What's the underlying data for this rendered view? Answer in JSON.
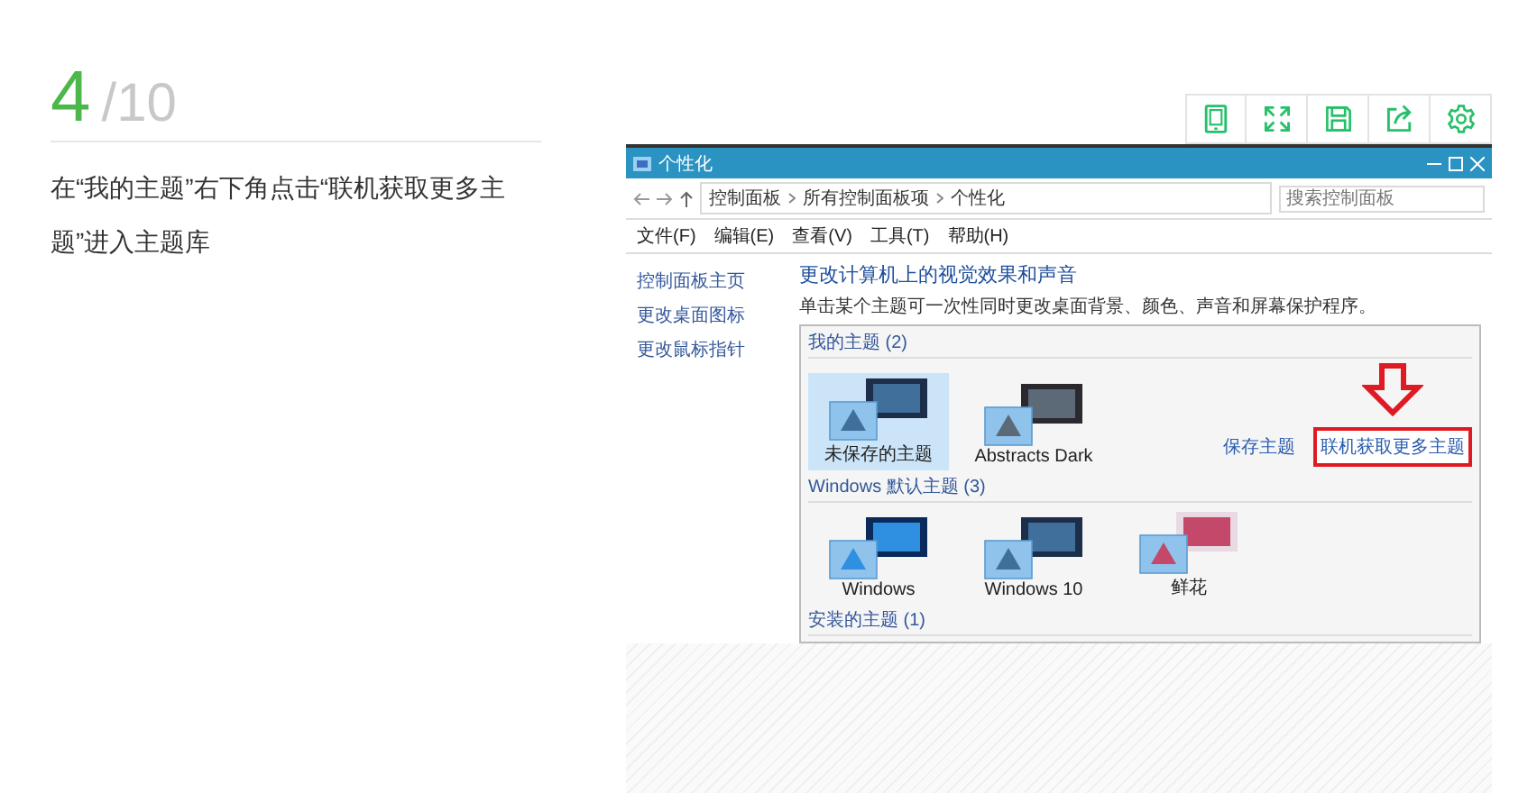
{
  "step": {
    "current": "4",
    "total": "/10"
  },
  "description": "在“我的主题”右下角点击“联机获取更多主题”进入主题库",
  "window": {
    "title": "个性化",
    "breadcrumb": [
      "控制面板",
      "所有控制面板项",
      "个性化"
    ],
    "search": {
      "placeholder": "搜索控制面板"
    },
    "menu": [
      "文件(F)",
      "编辑(E)",
      "查看(V)",
      "工具(T)",
      "帮助(H)"
    ],
    "sidebar": [
      "控制面板主页",
      "更改桌面图标",
      "更改鼠标指针"
    ],
    "heading": "更改计算机上的视觉效果和声音",
    "description": "单击某个主题可一次性同时更改桌面背景、颜色、声音和屏幕保护程序。",
    "groups": [
      {
        "title": "我的主题 (2)",
        "themes": [
          {
            "name": "未保存的主题",
            "kind": "custom",
            "selected": true
          },
          {
            "name": "Abstracts Dark",
            "kind": "dark",
            "selected": false
          }
        ],
        "links": [
          {
            "label": "保存主题",
            "highlighted": false
          },
          {
            "label": "联机获取更多主题",
            "highlighted": true
          }
        ]
      },
      {
        "title": "Windows 默认主题 (3)",
        "themes": [
          {
            "name": "Windows",
            "kind": "windows",
            "selected": false
          },
          {
            "name": "Windows 10",
            "kind": "custom",
            "selected": false
          },
          {
            "name": "鲜花",
            "kind": "flowers",
            "selected": false
          }
        ]
      },
      {
        "title": "安装的主题 (1)"
      }
    ]
  }
}
